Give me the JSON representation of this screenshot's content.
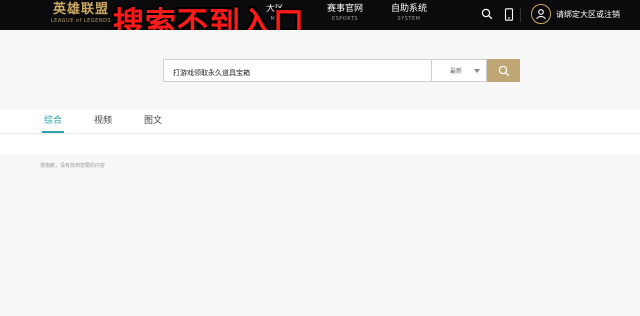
{
  "header": {
    "logo_cn": "英雄联盟",
    "logo_en": "LEAGUE of LEGENDS",
    "nav": [
      {
        "cn": "",
        "en": ""
      },
      {
        "cn": "",
        "en": ""
      },
      {
        "cn": "大区 ",
        "en": "MU"
      },
      {
        "cn": "赛事官网",
        "en": "ESPORTS"
      },
      {
        "cn": "自助系统",
        "en": "SYSTEM"
      }
    ],
    "login_text": "请绑定大区或注销",
    "icons": [
      "search-icon",
      "phone-icon",
      "user-icon"
    ]
  },
  "overlay_caption": "搜索不到入口",
  "search": {
    "value": "打游戏领取永久道具宝箱",
    "sort_selected": "最新",
    "button_icon": "search-icon"
  },
  "tabs": [
    {
      "label": "综合",
      "active": true
    },
    {
      "label": "视频",
      "active": false
    },
    {
      "label": "图文",
      "active": false
    }
  ],
  "results": {
    "empty_text": "很抱歉，没有找到您要的内容"
  },
  "colors": {
    "topbar_bg": "#0b0b0d",
    "gold": "#c9a763",
    "accent": "#2ba3ad",
    "search_button": "#c0a575",
    "caption_red": "#ff1a1a"
  }
}
